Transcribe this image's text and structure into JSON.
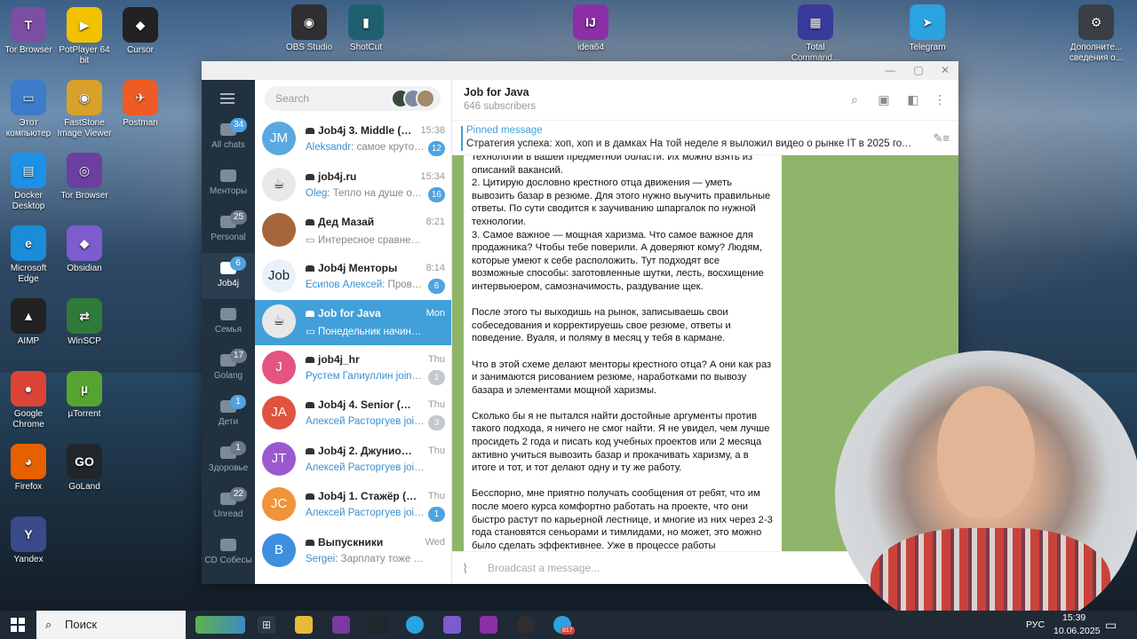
{
  "desktop": {
    "icons_left": [
      {
        "label": "Tor Browser",
        "color": "#7b4ea3",
        "glyph": "T"
      },
      {
        "label": "PotPlayer 64 bit",
        "color": "#f2c200",
        "glyph": "▶"
      },
      {
        "label": "Cursor",
        "color": "#222222",
        "glyph": "◆"
      },
      {
        "label": "Этот компьютер",
        "color": "#3c7cc9",
        "glyph": "▭"
      },
      {
        "label": "FastStone Image Viewer",
        "color": "#d9a02a",
        "glyph": "◉"
      },
      {
        "label": "Postman",
        "color": "#ef5b25",
        "glyph": "✈"
      },
      {
        "label": "Docker Desktop",
        "color": "#1d91e6",
        "glyph": "▤"
      },
      {
        "label": "Tor Browser",
        "color": "#6b3fa0",
        "glyph": "◎"
      },
      {
        "label": "Microsoft Edge",
        "color": "#1a8cd8",
        "glyph": "e"
      },
      {
        "label": "Obsidian",
        "color": "#7c5ccf",
        "glyph": "◆"
      },
      {
        "label": "AIMP",
        "color": "#222222",
        "glyph": "▲"
      },
      {
        "label": "WinSCP",
        "color": "#2f7a3a",
        "glyph": "⇄"
      },
      {
        "label": "Google Chrome",
        "color": "#db4437",
        "glyph": "●"
      },
      {
        "label": "µTorrent",
        "color": "#56a532",
        "glyph": "µ"
      },
      {
        "label": "Firefox",
        "color": "#e66000",
        "glyph": "◕"
      },
      {
        "label": "GoLand",
        "color": "#20262c",
        "glyph": "GO"
      },
      {
        "label": "Yandex",
        "color": "#3a4a8a",
        "glyph": "Y"
      }
    ],
    "icons_top": [
      {
        "label": "OBS Studio",
        "color": "#302e31",
        "glyph": "◉"
      },
      {
        "label": "ShotCut",
        "color": "#1e6070",
        "glyph": "▮"
      },
      {
        "label": "idea64",
        "color": "#8a2fa5",
        "glyph": "IJ"
      },
      {
        "label": "Total Command...",
        "color": "#3a3a9a",
        "glyph": "▦"
      },
      {
        "label": "Telegram",
        "color": "#2aa3e0",
        "glyph": "➤"
      },
      {
        "label": "Дополните... сведения о...",
        "color": "#3a3f45",
        "glyph": "⚙"
      }
    ]
  },
  "telegram": {
    "folders": [
      {
        "label": "All chats",
        "badge": "34",
        "badge_style": "blue"
      },
      {
        "label": "Менторы",
        "badge": ""
      },
      {
        "label": "Personal",
        "badge": "25"
      },
      {
        "label": "Job4j",
        "badge": "6",
        "badge_style": "blue",
        "active": true
      },
      {
        "label": "Семья",
        "badge": ""
      },
      {
        "label": "Golang",
        "badge": "17"
      },
      {
        "label": "Дети",
        "badge": "1",
        "badge_style": "blue"
      },
      {
        "label": "Здоровье",
        "badge": "1"
      },
      {
        "label": "Unread",
        "badge": "22"
      },
      {
        "label": "CD Собесы",
        "badge": ""
      }
    ],
    "search_placeholder": "Search",
    "chats": [
      {
        "avatar_text": "JM",
        "avatar_color": "#5aa8e0",
        "name": "Job4j 3. Middle (Thr...",
        "time": "15:38",
        "sender": "Aleksandr:",
        "preview": " самое крутое...",
        "unread": "12",
        "unread_style": "blue"
      },
      {
        "avatar_text": "☕",
        "avatar_color": "#e8e8e8",
        "name": "job4j.ru",
        "time": "15:34",
        "sender": "Oleg:",
        "preview": " Тепло на душе от т...",
        "unread": "16",
        "unread_style": "blue"
      },
      {
        "avatar_text": "",
        "avatar_color": "#a5663a",
        "name": "Дед Мазай",
        "time": "8:21",
        "sender": "",
        "preview": "▭ Интересное сравнени...",
        "unread": ""
      },
      {
        "avatar_text": "Job",
        "avatar_color": "#e9f2fb",
        "name": "Job4j Менторы",
        "time": "8:14",
        "sender": "Есипов Алексей:",
        "preview": " Провер...",
        "unread": "6",
        "unread_style": "blue"
      },
      {
        "avatar_text": "☕",
        "avatar_color": "#e8e8e8",
        "name": "Job for Java",
        "time": "Mon",
        "sender": "",
        "preview": "▭ Понедельник начинает...",
        "unread": "",
        "active": true
      },
      {
        "avatar_text": "J",
        "avatar_color": "#e5547e",
        "name": "job4j_hr",
        "time": "Thu",
        "sender": "Рустем Галиуллин joined...",
        "preview": "",
        "unread": "1",
        "unread_style": "gray"
      },
      {
        "avatar_text": "JA",
        "avatar_color": "#e0533f",
        "name": "Job4j 4. Senior (DevO...",
        "time": "Thu",
        "sender": "Алексей Расторгуев join...",
        "preview": "",
        "unread": "3",
        "unread_style": "gray"
      },
      {
        "avatar_text": "JT",
        "avatar_color": "#9b59d0",
        "name": "Job4j 2. Джуниор. Da...",
        "time": "Thu",
        "sender": "Алексей Расторгуев joined t...",
        "preview": "",
        "unread": ""
      },
      {
        "avatar_text": "JC",
        "avatar_color": "#f0943a",
        "name": "Job4j 1. Стажёр (Син...",
        "time": "Thu",
        "sender": "Алексей Расторгуев join...",
        "preview": "",
        "unread": "1",
        "unread_style": "blue"
      },
      {
        "avatar_text": "B",
        "avatar_color": "#3d8fe0",
        "name": "Выпускники",
        "time": "Wed",
        "sender": "Sergei:",
        "preview": " Зарплату тоже тайно ...",
        "unread": ""
      }
    ],
    "header": {
      "title": "Job for Java",
      "subtitle": "646 subscribers"
    },
    "pinned": {
      "title": "Pinned message",
      "text": "Стратегия успеха: хоп, хоп и в дамках   На той неделе я выложил видео о рынке IT в 2025 году. ..."
    },
    "message_paragraphs": [
      "технологии в вашей предметной области. Их можно взять из описаний вакансий.\n2. Цитирую дословно крестного отца движения — уметь вывозить базар в резюме. Для этого нужно выучить правильные ответы. По сути сводится к заучиванию шпаргалок по нужной технологии.\n3. Самое важное — мощная харизма. Что самое важное для продажника? Чтобы тебе поверили. А доверяют кому? Людям, которые умеют к себе расположить. Тут подходят все возможные способы: заготовленные шутки, лесть, восхищение интервьюером, самозначимость, раздувание щек.",
      "После этого ты выходишь на рынок, записываешь свои собеседования и корректируешь свое резюме, ответы и поведение. Вуаля, и поляму в месяц у тебя в кармане.",
      "Что в этой схеме делают менторы крестного отца? А они как раз и занимаются рисованием резюме, наработками по вывозу базара и элементами мощной харизмы.",
      "Сколько бы я не пытался найти достойные аргументы против такого подхода, я ничего не смог найти. Я не увидел, чем лучше просидеть 2 года и писать код учебных проектов или 2 месяца активно учиться вывозить базар и прокачивать харизму, а в итоге и тот, и тот делают одну и ту же работу.",
      "Бесспорно, мне приятно получать сообщения от ребят, что им после моего курса комфортно работать на проекте, что они быстро растут по карьерной лестнице, и многие из них через 2-3 года становятся сеньорами и тимлидами, но может, это можно было сделать эффективнее. Уже в процессе работы"
    ],
    "composer_placeholder": "Broadcast a message..."
  },
  "taskbar": {
    "search_text": "Поиск",
    "lang": "РУС",
    "time": "15:39",
    "date": "10.06.2025",
    "telegram_badge": "817"
  }
}
